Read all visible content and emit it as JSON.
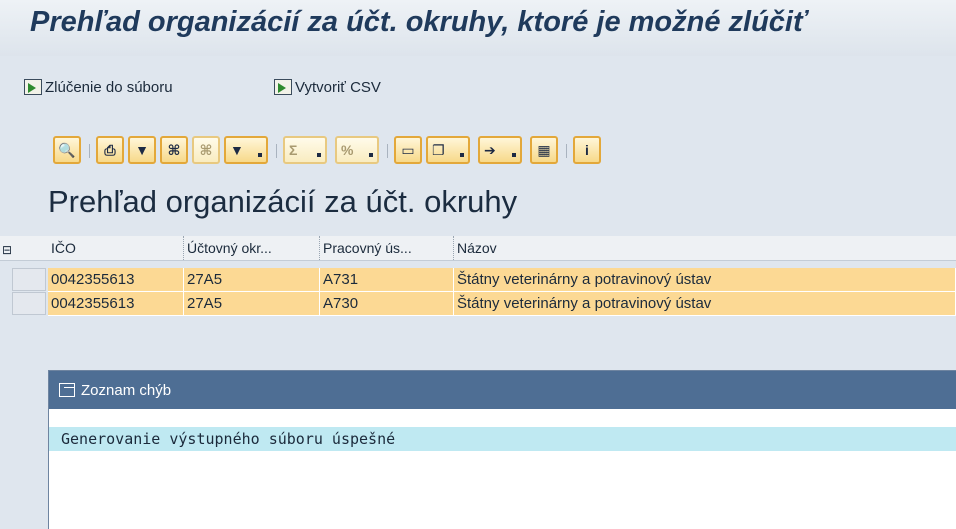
{
  "title": "Prehľad organizácií za účt. okruhy, ktoré je možné zlúčiť",
  "app_toolbar": {
    "merge_label": "Zlúčenie do súboru",
    "csv_label": "Vytvoriť CSV"
  },
  "alv_toolbar": {
    "buttons": [
      "details",
      "print",
      "filter-funnel",
      "find",
      "find-next",
      "set-filter",
      "sum",
      "subtotal",
      "print-preview",
      "export-word",
      "export-spreadsheet",
      "change-layout",
      "information"
    ]
  },
  "grid": {
    "title": "Prehľad organizácií za účt. okruhy",
    "columns": [
      "IČO",
      "Účtovný okr...",
      "Pracovný ús...",
      "Názov"
    ],
    "rows": [
      [
        "0042355613",
        "27A5",
        "A731",
        "Štátny veterinárny a potravinový ústav"
      ],
      [
        "0042355613",
        "27A5",
        "A730",
        "Štátny veterinárny a potravinový ústav"
      ]
    ],
    "row_color": "#fcd994"
  },
  "error_log": {
    "title": "Zoznam chýb",
    "message": "Generovanie výstupného súboru úspešné",
    "header_color": "#4e6e94",
    "message_highlight": "#bfe9f2"
  }
}
